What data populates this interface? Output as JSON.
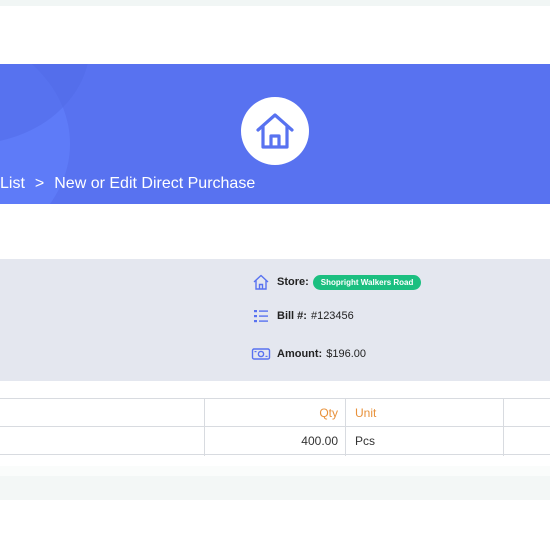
{
  "colors": {
    "banner": "#5872f0",
    "accent_orange": "#e8913a",
    "badge_green": "#1bbf80",
    "icon_blue": "#5872f0",
    "panel_bg": "#e4e7ef"
  },
  "header": {
    "icon": "home-icon",
    "breadcrumb": {
      "parent": "List",
      "separator": ">",
      "current": "New or Edit Direct Purchase"
    }
  },
  "info": {
    "store": {
      "icon": "home-outline-icon",
      "label": "Store:",
      "value": "Shopright Walkers Road"
    },
    "bill": {
      "icon": "list-icon",
      "label": "Bill #:",
      "value": "#123456"
    },
    "amount": {
      "icon": "cash-icon",
      "label": "Amount:",
      "value": "$196.00"
    }
  },
  "table": {
    "columns": [
      "Qty",
      "Unit"
    ],
    "rows": [
      {
        "qty": "400.00",
        "unit": "Pcs"
      }
    ]
  }
}
